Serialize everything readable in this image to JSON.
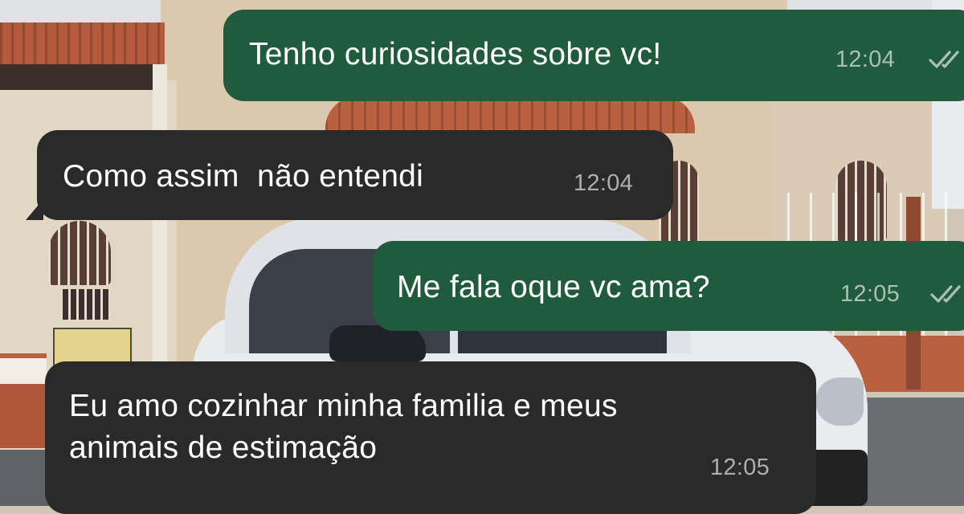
{
  "conversation": {
    "messages": [
      {
        "direction": "outgoing",
        "text": "Tenho curiosidades sobre vc!",
        "time": "12:04",
        "status_icon": "double-check-icon"
      },
      {
        "direction": "incoming",
        "text": "Como assim  não entendi",
        "time": "12:04"
      },
      {
        "direction": "outgoing",
        "text": "Me fala oque vc ama?",
        "time": "12:05",
        "status_icon": "double-check-icon"
      },
      {
        "direction": "incoming",
        "text": "Eu amo cozinhar minha familia e meus\nanimais de estimação",
        "time": "12:05"
      }
    ]
  },
  "colors": {
    "outgoing_bubble": "#1f5b3c",
    "incoming_bubble": "#2a2a2a",
    "message_text": "#ffffff",
    "time_text": "#a6a6a6"
  }
}
